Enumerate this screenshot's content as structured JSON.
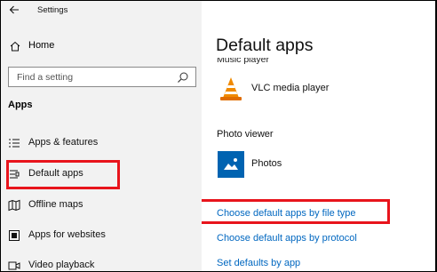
{
  "window": {
    "title": "Settings"
  },
  "sidebar": {
    "home_label": "Home",
    "search_placeholder": "Find a setting",
    "section_title": "Apps",
    "items": [
      {
        "label": "Apps & features",
        "icon": "apps-list-icon"
      },
      {
        "label": "Default apps",
        "icon": "default-apps-icon"
      },
      {
        "label": "Offline maps",
        "icon": "map-icon"
      },
      {
        "label": "Apps for websites",
        "icon": "web-apps-icon"
      },
      {
        "label": "Video playback",
        "icon": "video-icon"
      }
    ]
  },
  "main": {
    "title": "Default apps",
    "music_heading": "Music player",
    "music_app": "VLC media player",
    "photo_heading": "Photo viewer",
    "photo_app": "Photos",
    "links": [
      "Choose default apps by file type",
      "Choose default apps by protocol",
      "Set defaults by app"
    ]
  },
  "colors": {
    "sidebar_bg": "#f2f2f2",
    "link": "#0067c0",
    "highlight": "#e8141c",
    "photos_tile": "#0063b1"
  }
}
